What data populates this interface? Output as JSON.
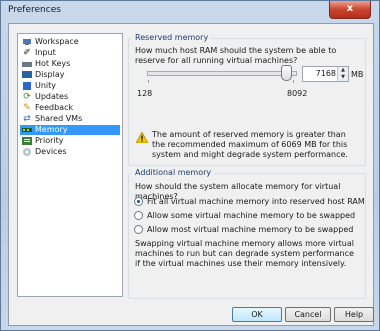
{
  "window": {
    "title": "Preferences",
    "close_glyph": "x"
  },
  "sidebar": {
    "items": [
      {
        "label": "Workspace",
        "icon": "workspace-icon"
      },
      {
        "label": "Input",
        "icon": "input-icon"
      },
      {
        "label": "Hot Keys",
        "icon": "hotkeys-icon"
      },
      {
        "label": "Display",
        "icon": "display-icon"
      },
      {
        "label": "Unity",
        "icon": "unity-icon"
      },
      {
        "label": "Updates",
        "icon": "updates-icon"
      },
      {
        "label": "Feedback",
        "icon": "feedback-icon"
      },
      {
        "label": "Shared VMs",
        "icon": "shared-vms-icon"
      },
      {
        "label": "Memory",
        "icon": "memory-icon",
        "selected": true
      },
      {
        "label": "Priority",
        "icon": "priority-icon"
      },
      {
        "label": "Devices",
        "icon": "devices-icon"
      }
    ]
  },
  "reserved": {
    "legend": "Reserved memory",
    "question": "How much host RAM should the system be able to reserve for all running virtual machines?",
    "value": "7168",
    "unit": "MB",
    "min_label": "128",
    "max_label": "8092",
    "warning": "The amount of reserved memory is greater than the recommended maximum of 6069 MB for this system and might degrade system performance."
  },
  "additional": {
    "legend": "Additional memory",
    "question": "How should the system allocate memory for virtual machines?",
    "options": [
      {
        "label": "Fit all virtual machine memory into reserved host RAM",
        "selected": true
      },
      {
        "label": "Allow some virtual machine memory to be swapped",
        "selected": false
      },
      {
        "label": "Allow most virtual machine memory to be swapped",
        "selected": false
      }
    ],
    "note": "Swapping virtual machine memory allows more virtual machines to run but can degrade system performance if the virtual machines use their memory intensively."
  },
  "buttons": {
    "ok": "OK",
    "cancel": "Cancel",
    "help": "Help"
  },
  "colors": {
    "selection": "#3399ff",
    "legend_text": "#1e3f72",
    "warning": "#f2c200"
  }
}
